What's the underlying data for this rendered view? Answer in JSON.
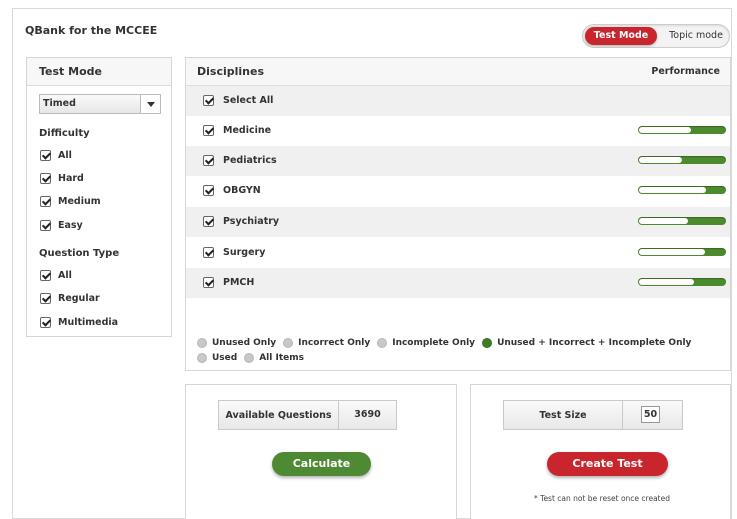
{
  "app": {
    "title": "QBank for the MCCEE"
  },
  "mode_toggle": {
    "active_label": "Test Mode",
    "inactive_label": "Topic mode"
  },
  "left_panel": {
    "title": "Test Mode",
    "mode_select": {
      "value": "Timed"
    },
    "difficulty": {
      "title": "Difficulty",
      "items": [
        {
          "label": "All",
          "checked": true
        },
        {
          "label": "Hard",
          "checked": true
        },
        {
          "label": "Medium",
          "checked": true
        },
        {
          "label": "Easy",
          "checked": true
        }
      ]
    },
    "question_type": {
      "title": "Question Type",
      "items": [
        {
          "label": "All",
          "checked": true
        },
        {
          "label": "Regular",
          "checked": true
        },
        {
          "label": "Multimedia",
          "checked": true
        }
      ]
    }
  },
  "disciplines": {
    "title": "Disciplines",
    "performance_title": "Performance",
    "select_all_label": "Select All",
    "items": [
      {
        "label": "Medicine",
        "checked": true,
        "performance_unfilled_fraction": 0.6
      },
      {
        "label": "Pediatrics",
        "checked": true,
        "performance_unfilled_fraction": 0.5
      },
      {
        "label": "OBGYN",
        "checked": true,
        "performance_unfilled_fraction": 0.78
      },
      {
        "label": "Psychiatry",
        "checked": true,
        "performance_unfilled_fraction": 0.57
      },
      {
        "label": "Surgery",
        "checked": true,
        "performance_unfilled_fraction": 0.77
      },
      {
        "label": "PMCH",
        "checked": true,
        "performance_unfilled_fraction": 0.64
      }
    ]
  },
  "question_filter": {
    "options": [
      {
        "label": "Unused Only",
        "selected": false
      },
      {
        "label": "Incorrect Only",
        "selected": false
      },
      {
        "label": "Incomplete Only",
        "selected": false
      },
      {
        "label": "Unused + Incorrect + Incomplete Only",
        "selected": true
      },
      {
        "label": "Used",
        "selected": false
      },
      {
        "label": "All Items",
        "selected": false
      }
    ]
  },
  "calculate": {
    "available_label": "Available Questions",
    "available_value": "3690",
    "button_label": "Calculate"
  },
  "create": {
    "size_label": "Test Size",
    "size_value": "50",
    "button_label": "Create Test",
    "note": "* Test can not be reset once created"
  },
  "colors": {
    "accent_red": "#c8252c",
    "accent_green": "#4e8a33",
    "perf_green": "#4c8a2e"
  }
}
